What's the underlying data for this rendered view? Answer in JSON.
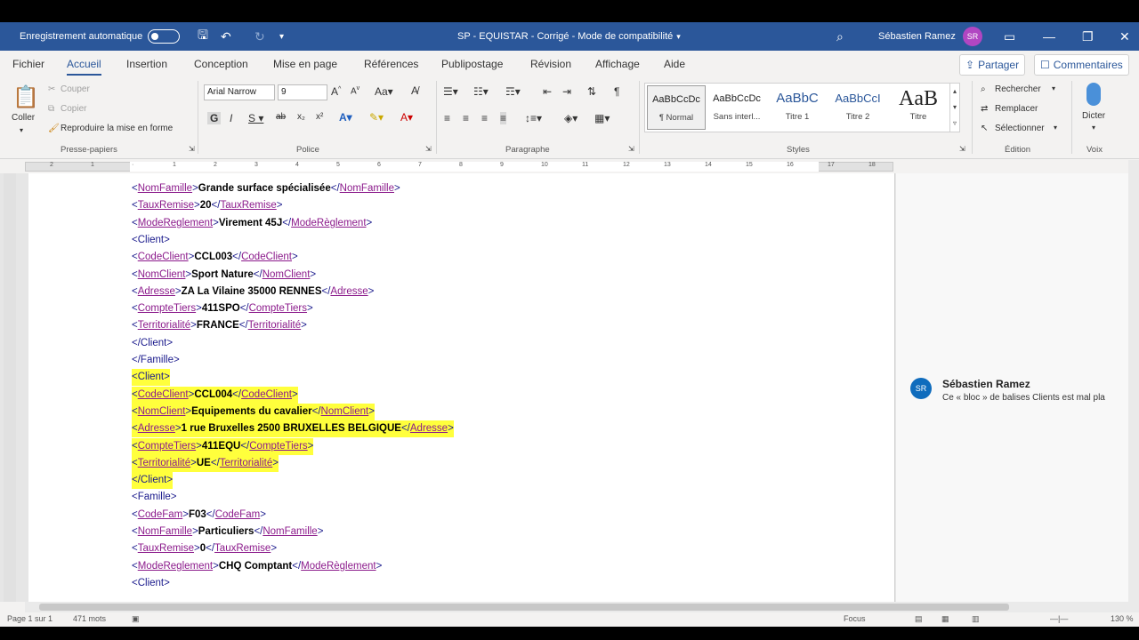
{
  "titlebar": {
    "autosave_label": "Enregistrement automatique",
    "doc_title": "SP - EQUISTAR - Corrigé - Mode de compatibilité",
    "user_name": "Sébastien Ramez",
    "user_initials": "SR"
  },
  "tabs": [
    "Fichier",
    "Accueil",
    "Insertion",
    "Conception",
    "Mise en page",
    "Références",
    "Publipostage",
    "Révision",
    "Affichage",
    "Aide"
  ],
  "actions": {
    "share": "Partager",
    "comments": "Commentaires"
  },
  "ribbon": {
    "clipboard": {
      "paste": "Coller",
      "cut": "Couper",
      "copy": "Copier",
      "format_painter": "Reproduire la mise en forme",
      "label": "Presse-papiers"
    },
    "font": {
      "name": "Arial Narrow",
      "size": "9",
      "label": "Police"
    },
    "paragraph": {
      "label": "Paragraphe"
    },
    "styles": {
      "label": "Styles",
      "items": [
        {
          "preview": "AaBbCcDc",
          "name": "¶ Normal"
        },
        {
          "preview": "AaBbCcDc",
          "name": "Sans interl..."
        },
        {
          "preview": "AaBbC",
          "name": "Titre 1"
        },
        {
          "preview": "AaBbCcI",
          "name": "Titre 2"
        },
        {
          "preview": "AaB",
          "name": "Titre"
        }
      ]
    },
    "editing": {
      "find": "Rechercher",
      "replace": "Remplacer",
      "select": "Sélectionner",
      "label": "Édition"
    },
    "voice": {
      "dictate": "Dicter",
      "label": "Voix"
    }
  },
  "document": {
    "lines": [
      {
        "open": "NomFamille",
        "text": "Grande surface spécialisée",
        "close": "NomFamille",
        "hl": false
      },
      {
        "open": "TauxRemise",
        "text": "20",
        "close": "TauxRemise",
        "hl": false
      },
      {
        "open": "ModeReglement",
        "text": "Virement 45J",
        "close": "ModeRèglement",
        "hl": false
      },
      {
        "open": "Client",
        "text": "",
        "close": "",
        "hl": false
      },
      {
        "open": "CodeClient",
        "text": "CCL003",
        "close": "CodeClient",
        "hl": false
      },
      {
        "open": "NomClient",
        "text": "Sport Nature",
        "close": "NomClient",
        "hl": false
      },
      {
        "open": "Adresse",
        "text": "ZA La Vilaine 35000 RENNES",
        "close": "Adresse",
        "hl": false
      },
      {
        "open": "CompteTiers",
        "text": "411SPO",
        "close": "CompteTiers",
        "hl": false
      },
      {
        "open": "Territorialité",
        "text": "FRANCE",
        "close": "Territorialité",
        "hl": false
      },
      {
        "open": "/Client",
        "text": "",
        "close": "",
        "hl": false
      },
      {
        "open": "/Famille",
        "text": "",
        "close": "",
        "hl": false
      },
      {
        "open": "Client",
        "text": "",
        "close": "",
        "hl": true
      },
      {
        "open": "CodeClient",
        "text": "CCL004",
        "close": "CodeClient",
        "hl": true
      },
      {
        "open": "NomClient",
        "text": "Equipements du cavalier",
        "close": "NomClient",
        "hl": true
      },
      {
        "open": "Adresse",
        "text": "1 rue Bruxelles 2500 BRUXELLES BELGIQUE",
        "close": "Adresse",
        "hl": true
      },
      {
        "open": "CompteTiers",
        "text": "411EQU",
        "close": "CompteTiers",
        "hl": true
      },
      {
        "open": "Territorialité",
        "text": "UE",
        "close": "Territorialité",
        "hl": true
      },
      {
        "open": "/Client",
        "text": "",
        "close": "",
        "hl": true
      },
      {
        "open": "Famille",
        "text": "",
        "close": "",
        "hl": false
      },
      {
        "open": "CodeFam",
        "text": "F03",
        "close": "CodeFam",
        "hl": false
      },
      {
        "open": "NomFamille",
        "text": "Particuliers",
        "close": "NomFamille",
        "hl": false
      },
      {
        "open": "TauxRemise",
        "text": "0",
        "close": "TauxRemise",
        "hl": false
      },
      {
        "open": "ModeReglement",
        "text": "CHQ Comptant",
        "close": "ModeRèglement",
        "hl": false
      },
      {
        "open": "Client",
        "text": "",
        "close": "",
        "hl": false
      }
    ]
  },
  "comment": {
    "initials": "SR",
    "author": "Sébastien Ramez",
    "text": "Ce « bloc » de balises Clients est mal pla"
  },
  "status": {
    "page": "Page 1 sur 1",
    "words": "471 mots",
    "focus": "Focus",
    "zoom": "130 %"
  }
}
